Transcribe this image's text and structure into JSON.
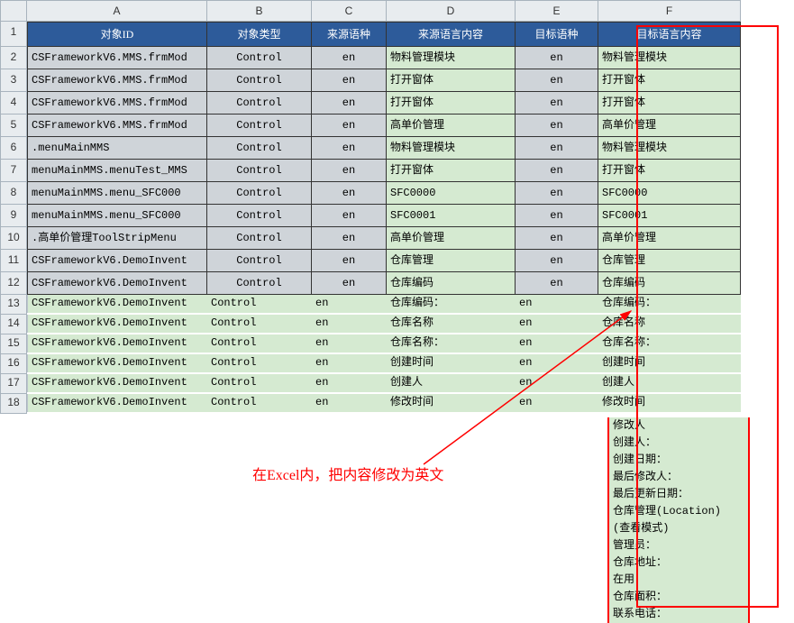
{
  "cols": [
    "A",
    "B",
    "C",
    "D",
    "E",
    "F"
  ],
  "headers": {
    "A": "对象ID",
    "B": "对象类型",
    "C": "来源语种",
    "D": "来源语言内容",
    "E": "目标语种",
    "F": "目标语言内容"
  },
  "rows": [
    {
      "n": 2,
      "faded": false,
      "A": "CSFrameworkV6.MMS.frmMod",
      "B": "Control",
      "C": "en",
      "D": "物料管理模块",
      "E": "en",
      "F": "物料管理模块"
    },
    {
      "n": 3,
      "faded": false,
      "A": "CSFrameworkV6.MMS.frmMod",
      "B": "Control",
      "C": "en",
      "D": "打开窗体",
      "E": "en",
      "F": "打开窗体"
    },
    {
      "n": 4,
      "faded": false,
      "A": "CSFrameworkV6.MMS.frmMod",
      "B": "Control",
      "C": "en",
      "D": "打开窗体",
      "E": "en",
      "F": "打开窗体"
    },
    {
      "n": 5,
      "faded": false,
      "A": "CSFrameworkV6.MMS.frmMod",
      "B": "Control",
      "C": "en",
      "D": "高单价管理",
      "E": "en",
      "F": "高单价管理"
    },
    {
      "n": 6,
      "faded": false,
      "A": ".menuMainMMS",
      "B": "Control",
      "C": "en",
      "D": "物料管理模块",
      "E": "en",
      "F": "物料管理模块"
    },
    {
      "n": 7,
      "faded": false,
      "A": "menuMainMMS.menuTest_MMS",
      "B": "Control",
      "C": "en",
      "D": "打开窗体",
      "E": "en",
      "F": "打开窗体"
    },
    {
      "n": 8,
      "faded": false,
      "A": "menuMainMMS.menu_SFC000",
      "B": "Control",
      "C": "en",
      "D": "SFC0000",
      "E": "en",
      "F": "SFC0000"
    },
    {
      "n": 9,
      "faded": false,
      "A": "menuMainMMS.menu_SFC000",
      "B": "Control",
      "C": "en",
      "D": "SFC0001",
      "E": "en",
      "F": "SFC0001"
    },
    {
      "n": 10,
      "faded": false,
      "A": ".高单价管理ToolStripMenu",
      "B": "Control",
      "C": "en",
      "D": "高单价管理",
      "E": "en",
      "F": "高单价管理"
    },
    {
      "n": 11,
      "faded": false,
      "A": "CSFrameworkV6.DemoInvent",
      "B": "Control",
      "C": "en",
      "D": "仓库管理",
      "E": "en",
      "F": "仓库管理"
    },
    {
      "n": 12,
      "faded": false,
      "A": "CSFrameworkV6.DemoInvent",
      "B": "Control",
      "C": "en",
      "D": "仓库编码",
      "E": "en",
      "F": "仓库编码"
    },
    {
      "n": 13,
      "faded": true,
      "A": "CSFrameworkV6.DemoInvent",
      "B": "Control",
      "C": "en",
      "D": "仓库编码：",
      "E": "en",
      "F": "仓库编码："
    },
    {
      "n": 14,
      "faded": true,
      "A": "CSFrameworkV6.DemoInvent",
      "B": "Control",
      "C": "en",
      "D": "仓库名称",
      "E": "en",
      "F": "仓库名称"
    },
    {
      "n": 15,
      "faded": true,
      "A": "CSFrameworkV6.DemoInvent",
      "B": "Control",
      "C": "en",
      "D": "仓库名称：",
      "E": "en",
      "F": "仓库名称："
    },
    {
      "n": 16,
      "faded": true,
      "A": "CSFrameworkV6.DemoInvent",
      "B": "Control",
      "C": "en",
      "D": "创建时间",
      "E": "en",
      "F": "创建时间"
    },
    {
      "n": 17,
      "faded": true,
      "A": "CSFrameworkV6.DemoInvent",
      "B": "Control",
      "C": "en",
      "D": "创建人",
      "E": "en",
      "F": "创建人"
    },
    {
      "n": 18,
      "faded": true,
      "A": "CSFrameworkV6.DemoInvent",
      "B": "Control",
      "C": "en",
      "D": "修改时间",
      "E": "en",
      "F": "修改时间"
    }
  ],
  "f_extra": [
    "修改人",
    "创建人：",
    "创建日期：",
    "最后修改人：",
    "最后更新日期：",
    "仓库管理(Location)",
    " (查看模式)",
    "管理员：",
    "仓库地址：",
    "在用",
    "仓库面积：",
    "联系电话："
  ],
  "note": "在Excel内，把内容修改为英文"
}
